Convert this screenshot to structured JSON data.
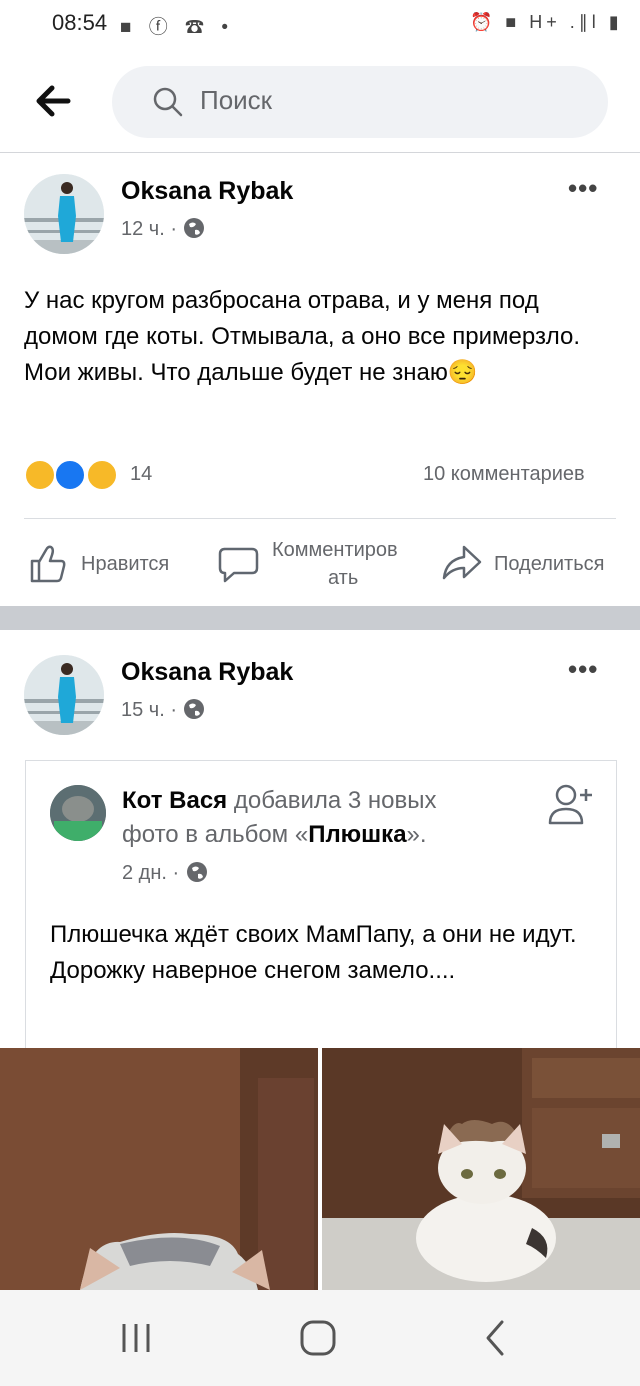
{
  "status_bar": {
    "time": "08:54",
    "notif_icons": "■ ⓕ ☎ •",
    "right_icons": "⏰ ■ H+ .∥l ▮"
  },
  "header": {
    "search_placeholder": "Поиск"
  },
  "post1": {
    "author": "Oksana Rybak",
    "time": "12 ч. ·",
    "text": "У нас кругом разбросана отрава, и  у меня под домом где коты. Отмывала, а оно все примерзло. Мои живы. Что дальше будет не знаю😔",
    "reactions_count": "14",
    "comments_count": "10 комментариев",
    "actions": {
      "like": "Нравится",
      "comment_line1": "Комментиров",
      "comment_line2": "ать",
      "share": "Поделиться"
    }
  },
  "post2": {
    "author": "Oksana Rybak",
    "time": "15 ч. ·",
    "shared": {
      "author": "Кот Вася",
      "action_line1": " добавила 3 новых",
      "action_line2_pre": "фото в альбом «",
      "album": "Плюшка",
      "action_line2_post": "».",
      "time": "2 дн. ·",
      "text": "Плюшечка ждёт своих МамПапу, а они не идут. Дорожку наверное снегом замело...."
    }
  },
  "colors": {
    "facebook_blue": "#1877f2",
    "separator_gray": "#c9ccd1",
    "secondary_text": "#65676b"
  },
  "icons": {
    "back": "arrow-left-icon",
    "search": "search-icon",
    "more": "more-dots-icon",
    "globe": "globe-icon",
    "like": "thumb-up-icon",
    "comment": "comment-bubble-icon",
    "share": "share-arrow-icon",
    "add_friend": "add-friend-icon"
  }
}
